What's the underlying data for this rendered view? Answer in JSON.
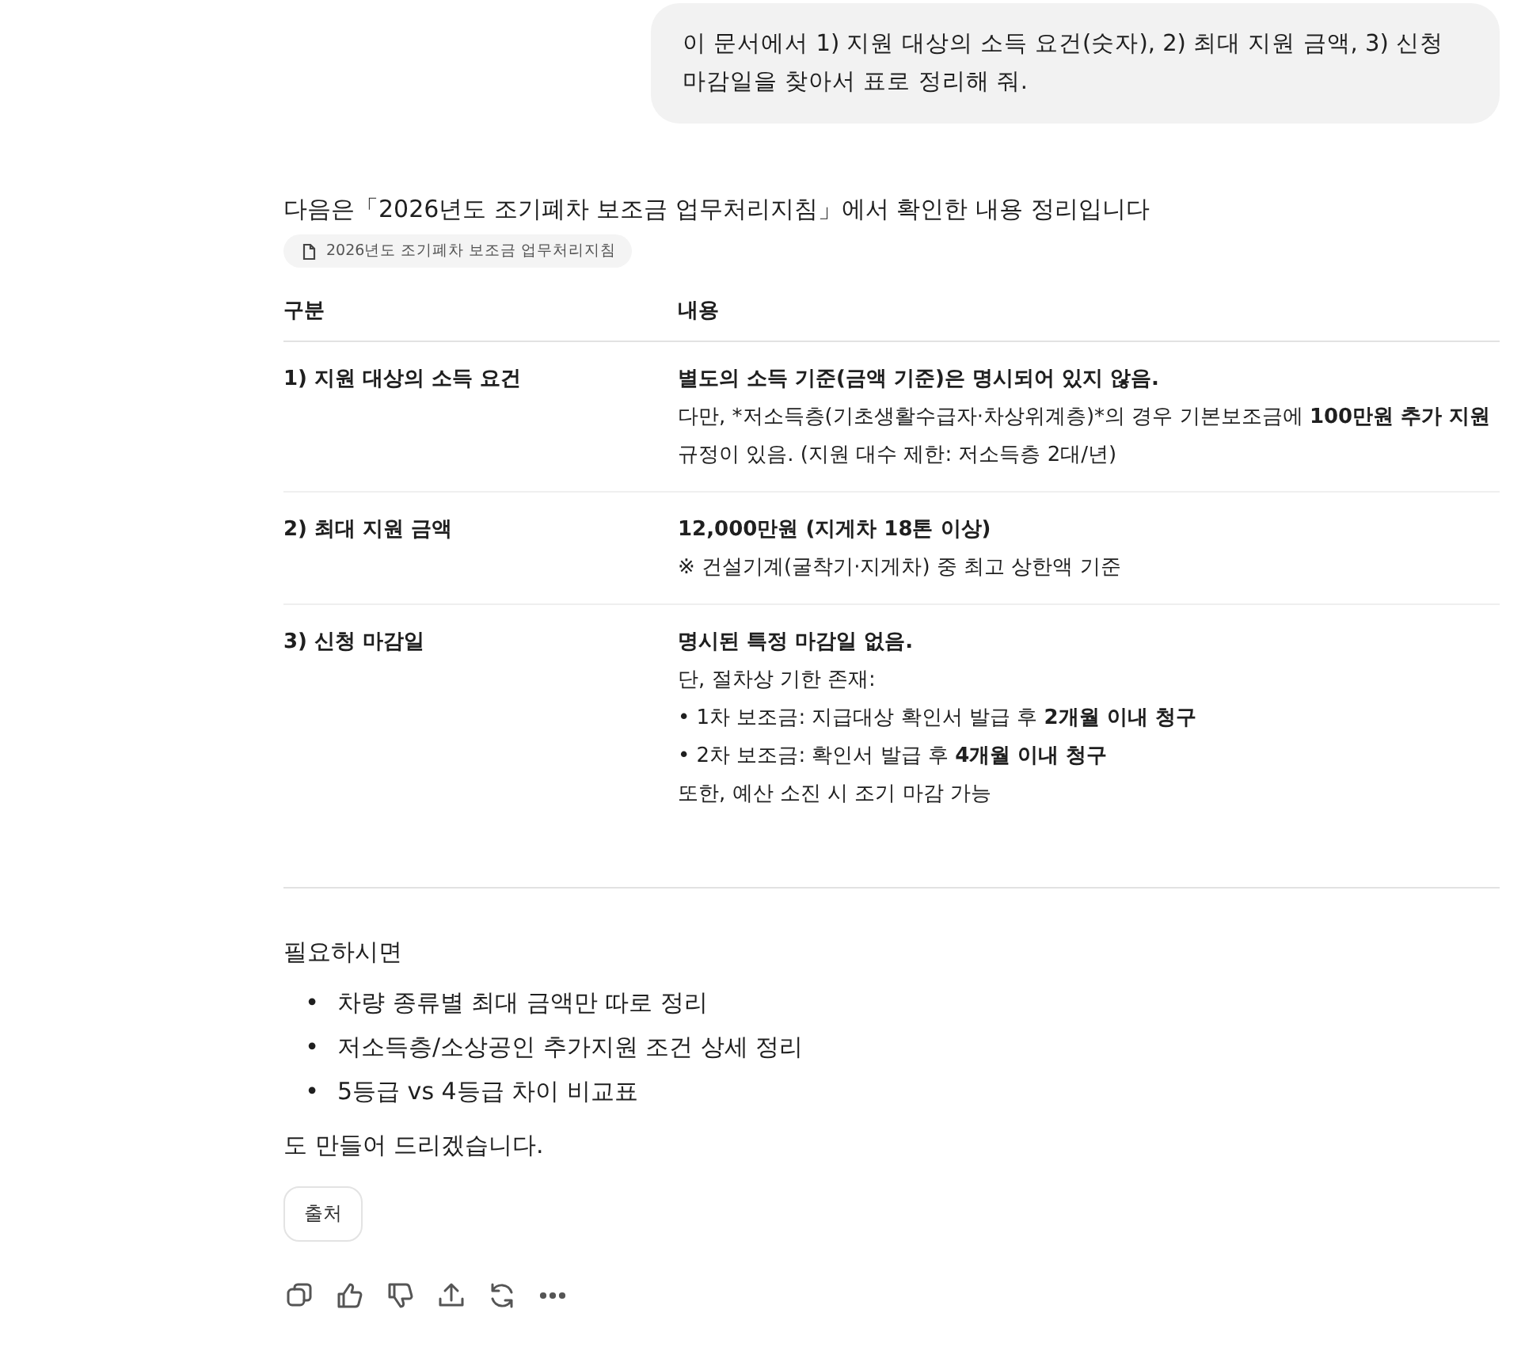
{
  "user_message": "이 문서에서 1) 지원 대상의 소득 요건(숫자), 2) 최대 지원 금액, 3) 신청 마감일을 찾아서 표로 정리해 줘.",
  "answer": {
    "intro": "다음은「2026년도 조기폐차 보조금 업무처리지침」에서 확인한 내용 정리입니다",
    "source_chip": "2026년도 조기폐차 보조금 업무처리지침",
    "table": {
      "columns": [
        "구분",
        "내용"
      ],
      "rows": [
        {
          "label": "1) 지원 대상의 소득 요건",
          "lines": [
            [
              {
                "text": "별도의 소득 기준(금액 기준)은 명시되어 있지 않음.",
                "bold": true
              }
            ],
            [
              {
                "text": "다만, *저소득층(기초생활수급자·차상위계층)*의 경우 기본보조금에 ",
                "bold": false
              },
              {
                "text": "100만원 추가 지원",
                "bold": true
              },
              {
                "text": " 규정이 있음. (지원 대수 제한: 저소득층 2대/년)",
                "bold": false
              }
            ]
          ]
        },
        {
          "label": "2) 최대 지원 금액",
          "lines": [
            [
              {
                "text": "12,000만원 (지게차 18톤 이상)",
                "bold": true
              }
            ],
            [
              {
                "text": "※ 건설기계(굴착기·지게차) 중 최고 상한액 기준",
                "bold": false
              }
            ]
          ]
        },
        {
          "label": "3) 신청 마감일",
          "lines": [
            [
              {
                "text": "명시된 특정 마감일 없음.",
                "bold": true
              }
            ],
            [
              {
                "text": "단, 절차상 기한 존재:",
                "bold": false
              }
            ],
            [
              {
                "text": "• 1차 보조금: 지급대상 확인서 발급 후 ",
                "bold": false
              },
              {
                "text": "2개월 이내 청구",
                "bold": true
              }
            ],
            [
              {
                "text": "• 2차 보조금: 확인서 발급 후 ",
                "bold": false
              },
              {
                "text": "4개월 이내 청구",
                "bold": true
              }
            ],
            [
              {
                "text": "또한, 예산 소진 시 조기 마감 가능",
                "bold": false
              }
            ]
          ]
        }
      ]
    },
    "offer_lead": "필요하시면",
    "offers": [
      {
        "bullet": "•",
        "text": "차량 종류별 최대 금액만 따로 정리"
      },
      {
        "bullet": "•",
        "text": "저소득층/소상공인 추가지원 조건 상세 정리"
      },
      {
        "bullet": "•",
        "text": "5등급 vs 4등급 차이 비교표"
      }
    ],
    "offer_tail": "도 만들어 드리겠습니다.",
    "sources_button": "출처",
    "actions": [
      {
        "kind": "copy"
      },
      {
        "kind": "like"
      },
      {
        "kind": "dislike"
      },
      {
        "kind": "share"
      },
      {
        "kind": "regenerate"
      },
      {
        "kind": "more"
      }
    ]
  }
}
